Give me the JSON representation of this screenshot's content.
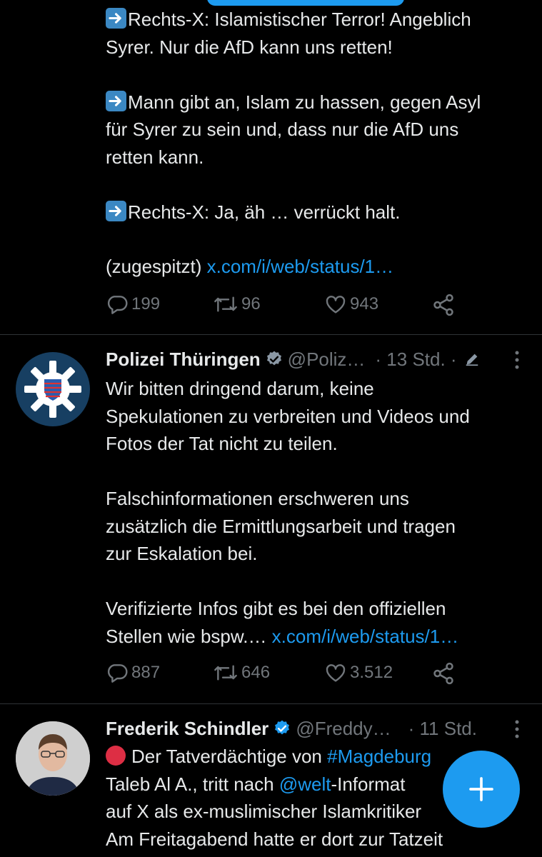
{
  "tweet1": {
    "lines": [
      {
        "emoji": "arrow-right",
        "text": "Rechts-X: Islamistischer Terror! Angeblich"
      },
      {
        "text": "Syrer. Nur die AfD kann uns retten!"
      },
      {
        "gap": true
      },
      {
        "emoji": "arrow-right",
        "text": "Mann gibt an, Islam zu hassen, gegen Asyl"
      },
      {
        "text": "für Syrer zu sein und, dass nur die AfD uns"
      },
      {
        "text": "retten kann."
      },
      {
        "gap": true
      },
      {
        "emoji": "arrow-right",
        "text": "Rechts-X: Ja, äh … verrückt halt."
      },
      {
        "gap": true
      }
    ],
    "last_text": "(zugespitzt) ",
    "link": "x.com/i/web/status/1…",
    "replies": "199",
    "reposts": "96",
    "likes": "943"
  },
  "tweet2": {
    "name": "Polizei Thüringen",
    "handle": "@Poliz…",
    "time": "· 13 Std. ·",
    "line1": "Wir bitten dringend darum, keine",
    "line2": "Spekulationen zu verbreiten und Videos und",
    "line3": "Fotos der Tat nicht zu teilen.",
    "line4": "Falschinformationen erschweren uns",
    "line5": "zusätzlich die Ermittlungsarbeit und tragen",
    "line6": "zur Eskalation bei.",
    "line7": "Verifizierte Infos gibt es bei den offiziellen",
    "line8": "Stellen wie bspw.… ",
    "link": "x.com/i/web/status/1…",
    "replies": "887",
    "reposts": "646",
    "likes": "3.512"
  },
  "tweet3": {
    "name": "Frederik Schindler",
    "handle": "@Freddy…",
    "time": "· 11 Std.",
    "line1_text": "Der Tatverdächtige von ",
    "line1_tag": "#Magdeburg",
    "line2_text": "Taleb Al A., tritt nach ",
    "line2_mention": "@welt",
    "line2_rest": "-Informat",
    "line3": "auf X als ex-muslimischer Islamkritiker",
    "line4": "Am Freitagabend hatte er dort zur Tatzeit"
  },
  "icons": {
    "reply": "reply-icon",
    "repost": "repost-icon",
    "like": "like-icon",
    "share": "share-icon",
    "verified": "verified-badge-icon",
    "edited": "edited-pencil-icon",
    "more": "more-options-icon",
    "compose": "compose-plus-icon"
  },
  "colors": {
    "background": "#000000",
    "text": "#e7e9ea",
    "muted": "#71767b",
    "accent": "#1d9bf0",
    "divider": "#2f3336"
  }
}
